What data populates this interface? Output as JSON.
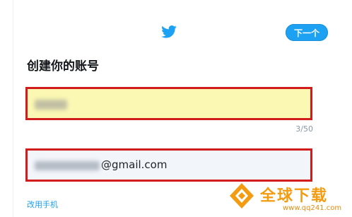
{
  "header": {
    "logo_icon": "twitter-bird-icon",
    "next_label": "下一个",
    "accent_color": "#1da1f2"
  },
  "form": {
    "title": "创建你的账号",
    "name_counter": "3/50",
    "email_suffix": "@gmail.com",
    "switch_label": "改用手机",
    "highlight_color": "#d01c1c"
  },
  "watermark": {
    "text": "全球下载",
    "url": "www.qq241.com"
  }
}
